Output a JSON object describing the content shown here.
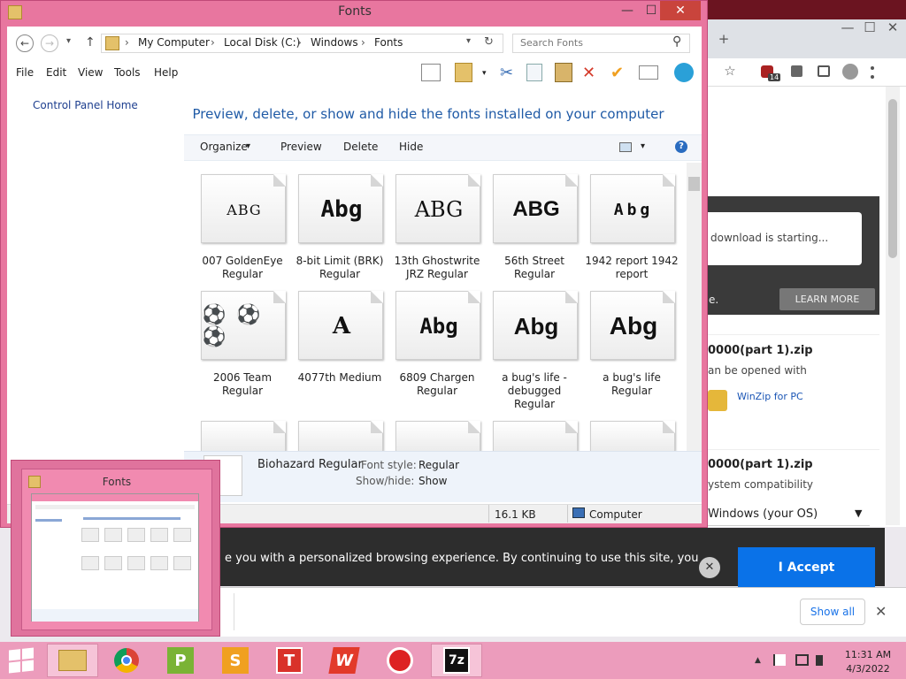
{
  "window": {
    "title": "Fonts",
    "minimize": "—",
    "maximize": "☐",
    "close": "✕"
  },
  "nav": {
    "back": "←",
    "forward": "→",
    "recent": "▾",
    "up": "↑",
    "refresh": "↻"
  },
  "address": {
    "crumbs": [
      "My Computer",
      "Local Disk (C:)",
      "Windows",
      "Fonts"
    ],
    "separator": "›",
    "dropdown": "▾"
  },
  "search": {
    "placeholder": "Search Fonts",
    "icon": "⚲"
  },
  "menu": [
    "File",
    "Edit",
    "View",
    "Tools",
    "Help"
  ],
  "left_pane": {
    "control_panel_home": "Control Panel Home"
  },
  "heading": "Preview, delete, or show and hide the fonts installed on your computer",
  "commands": {
    "organize": "Organize",
    "organize_arrow": "▾",
    "preview": "Preview",
    "delete": "Delete",
    "hide": "Hide",
    "view_arrow": "▾",
    "help": "?"
  },
  "fonts": [
    {
      "sample": "ABG",
      "name": "007 GoldenEye Regular"
    },
    {
      "sample": "Abg",
      "name": "8-bit Limit (BRK) Regular"
    },
    {
      "sample": "ABG",
      "name": "13th Ghostwrite JRZ Regular"
    },
    {
      "sample": "ABG",
      "name": "56th Street Regular"
    },
    {
      "sample": "Abg",
      "name": "1942 report 1942 report"
    },
    {
      "sample": "⚽ ⚽ ⚽",
      "name": "2006 Team Regular"
    },
    {
      "sample": "A",
      "name": "4077th Medium"
    },
    {
      "sample": "Abg",
      "name": "6809 Chargen Regular"
    },
    {
      "sample": "Abg",
      "name": "a bug's life - debugged Regular"
    },
    {
      "sample": "Abg",
      "name": "a bug's life Regular"
    }
  ],
  "details": {
    "name": "Biohazard Regular",
    "style_label": "Font style:",
    "style_value": "Regular",
    "showhide_label": "Show/hide:",
    "showhide_value": "Show"
  },
  "status": {
    "size": "16.1 KB",
    "location": "Computer"
  },
  "thumbnail": {
    "title": "Fonts"
  },
  "browser": {
    "tab_new": "+",
    "win_min": "—",
    "win_max": "☐",
    "win_close": "✕",
    "bookmark": "☆",
    "ext_badge": "14",
    "download_text": "download is starting...",
    "promo_suffix": "e.",
    "learn_more": "LEARN MORE",
    "file1_name": "0000(part 1).zip",
    "file1_desc": "an be opened with",
    "file1_app": "WinZip for PC",
    "file2_name": "0000(part 1).zip",
    "file2_desc": "ystem compatibility",
    "os_select": "Windows (your OS)",
    "os_select_arrow": "▼",
    "cookie_text": "e you with a personalized browsing experience. By continuing to use this site, you",
    "cookie_close": "✕",
    "accept": "I Accept",
    "show_all": "Show all",
    "dlbar_close": "✕"
  },
  "taskbar": {
    "apps": [
      "File Explorer",
      "Chrome",
      "P",
      "S",
      "T",
      "W",
      "Power",
      "7z"
    ],
    "labels": {
      "p": "P",
      "s": "S",
      "t": "T",
      "w": "W",
      "z": "7z"
    },
    "tray_arrow": "▲",
    "time": "11:31 AM",
    "date": "4/3/2022"
  },
  "colors": {
    "accent": "#e8769f",
    "link": "#1e3f8f",
    "heading": "#1f5aa6",
    "accept": "#0a72e8"
  }
}
